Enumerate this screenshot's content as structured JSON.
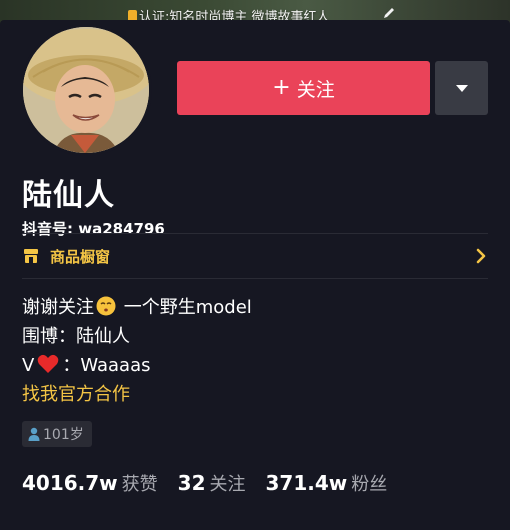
{
  "banner": {
    "text": "认证:知名时尚博主 微博故事红人"
  },
  "profile": {
    "name": "陆仙人",
    "douyin_id": "抖音号: wa284796"
  },
  "actions": {
    "follow_label": "关注",
    "follow_plus": "+"
  },
  "shop": {
    "label": "商品橱窗"
  },
  "bio": {
    "line1_a": "谢谢关注",
    "line1_b": "一个野生model",
    "line2": "围博：陆仙人",
    "line3_a": "V",
    "line3_b": "：Waaaas",
    "line4": "找我官方合作"
  },
  "age_tag": {
    "label": "101岁"
  },
  "stats": [
    {
      "value": "4016.7w",
      "label": "获赞"
    },
    {
      "value": "32",
      "label": "关注"
    },
    {
      "value": "371.4w",
      "label": "粉丝"
    }
  ],
  "colors": {
    "background": "#161722",
    "follow_button": "#ea4359",
    "accent_yellow": "#f4c545",
    "secondary_text": "#a8a9b0"
  },
  "icons": {
    "banner_badge": "verified-badge-icon",
    "banner_edit": "pencil-icon",
    "more": "caret-down-icon",
    "shop": "shop-window-icon",
    "chevron": "chevron-right-icon",
    "face_emoji": "kissing-face-icon",
    "heart_emoji": "red-heart-icon",
    "age": "person-icon"
  }
}
